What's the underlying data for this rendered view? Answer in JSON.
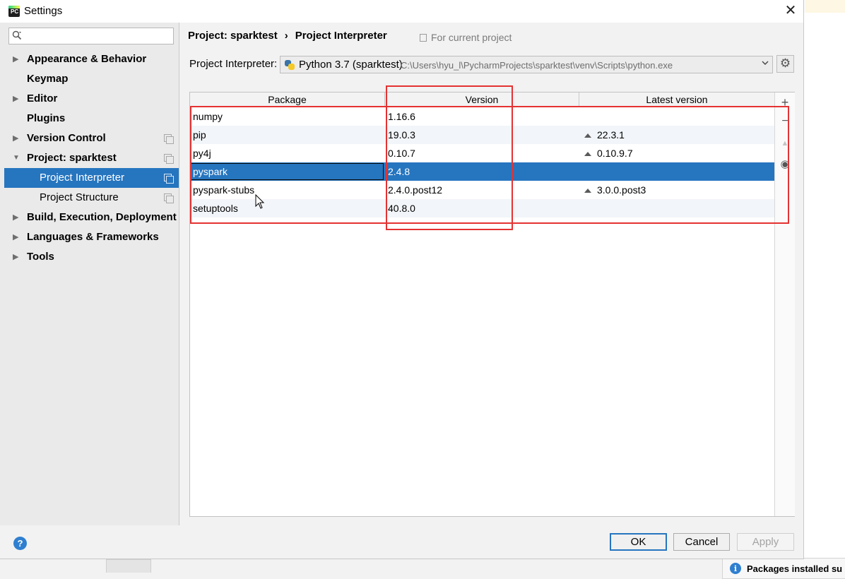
{
  "window": {
    "title": "Settings"
  },
  "search": {
    "placeholder": ""
  },
  "sidebar": {
    "items": [
      {
        "label": "Appearance & Behavior",
        "expandable": true,
        "bold": true,
        "copy": false
      },
      {
        "label": "Keymap",
        "expandable": false,
        "bold": true,
        "copy": false
      },
      {
        "label": "Editor",
        "expandable": true,
        "bold": true,
        "copy": false
      },
      {
        "label": "Plugins",
        "expandable": false,
        "bold": true,
        "copy": false
      },
      {
        "label": "Version Control",
        "expandable": true,
        "bold": true,
        "copy": true
      },
      {
        "label": "Project: sparktest",
        "expandable": true,
        "expanded": true,
        "bold": true,
        "copy": true
      },
      {
        "label": "Project Interpreter",
        "child": true,
        "selected": true,
        "copy": true
      },
      {
        "label": "Project Structure",
        "child": true,
        "copy": true
      },
      {
        "label": "Build, Execution, Deployment",
        "expandable": true,
        "bold": true,
        "copy": false
      },
      {
        "label": "Languages & Frameworks",
        "expandable": true,
        "bold": true,
        "copy": false
      },
      {
        "label": "Tools",
        "expandable": true,
        "bold": true,
        "copy": false
      }
    ]
  },
  "breadcrumb": {
    "project": "Project: sparktest",
    "separator": "›",
    "page": "Project Interpreter",
    "scope": "For current project"
  },
  "interpreter": {
    "label": "Project Interpreter:",
    "name": "Python 3.7 (sparktest)",
    "path": "C:\\Users\\hyu_l\\PycharmProjects\\sparktest\\venv\\Scripts\\python.exe"
  },
  "packages": {
    "columns": [
      "Package",
      "Version",
      "Latest version"
    ],
    "rows": [
      {
        "package": "numpy",
        "version": "1.16.6",
        "latest": ""
      },
      {
        "package": "pip",
        "version": "19.0.3",
        "latest": "22.3.1"
      },
      {
        "package": "py4j",
        "version": "0.10.7",
        "latest": "0.10.9.7"
      },
      {
        "package": "pyspark",
        "version": "2.4.8",
        "latest": "",
        "selected": true
      },
      {
        "package": "pyspark-stubs",
        "version": "2.4.0.post12",
        "latest": "3.0.0.post3"
      },
      {
        "package": "setuptools",
        "version": "40.8.0",
        "latest": ""
      }
    ]
  },
  "side_tools": {
    "add": "+",
    "remove": "−",
    "upgrade": "▲",
    "show_early": "◉"
  },
  "buttons": {
    "ok": "OK",
    "cancel": "Cancel",
    "apply": "Apply",
    "help": "?"
  },
  "notification": {
    "text": "Packages installed su"
  },
  "colors": {
    "selection": "#2675bf",
    "annotation": "#e53232"
  }
}
